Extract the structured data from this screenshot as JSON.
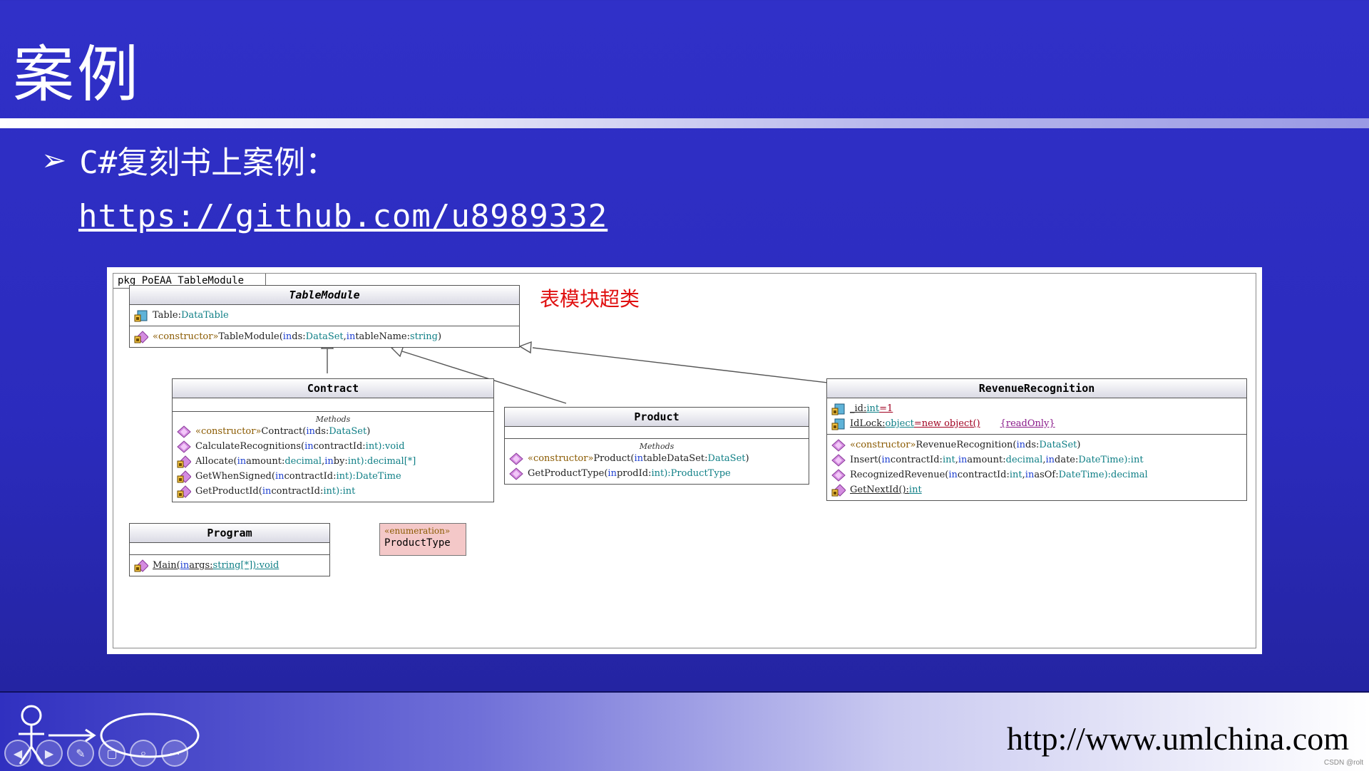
{
  "slide": {
    "title": "案例",
    "bullet": "C#复刻书上案例：",
    "link": "https://github.com/u8989332",
    "footer_url": "http://www.umlchina.com",
    "credit": "CSDN @rolt"
  },
  "diagram": {
    "package_label": "pkg PoEAA_TableModule",
    "note": "表模块超类",
    "methods_label": "Methods",
    "table_module": {
      "name": "TableModule",
      "attr_name": "Table:",
      "attr_type": "DataTable",
      "ctor_stereo": "«constructor»",
      "ctor_name": " TableModule(",
      "ctor_in1": "in",
      "ctor_p1": " ds:",
      "ctor_t1": "DataSet",
      "ctor_sep": ", ",
      "ctor_in2": "in",
      "ctor_p2": " tableName:",
      "ctor_t2": "string",
      "ctor_end": ")"
    },
    "contract": {
      "name": "Contract",
      "m1_stereo": "«constructor»",
      "m1_name": " Contract(",
      "m1_in": "in",
      "m1_p": " ds:",
      "m1_t": "DataSet",
      "m1_end": ")",
      "m2_name": "CalculateRecognitions(",
      "m2_in": "in",
      "m2_p": " contractId:",
      "m2_t": "int",
      "m2_r": "):void",
      "m3_name": "Allocate(",
      "m3_in1": "in",
      "m3_p1": " amount:",
      "m3_t1": "decimal",
      "m3_sep": ", ",
      "m3_in2": "in",
      "m3_p2": " by:",
      "m3_t2": "int",
      "m3_r": "):decimal[*]",
      "m4_name": "GetWhenSigned(",
      "m4_in": "in",
      "m4_p": " contractId:",
      "m4_t": "int",
      "m4_r": "):DateTime",
      "m5_name": "GetProductId(",
      "m5_in": "in",
      "m5_p": " contractId:",
      "m5_t": "int",
      "m5_r": "):int"
    },
    "product": {
      "name": "Product",
      "m1_stereo": "«constructor»",
      "m1_name": " Product(",
      "m1_in": "in",
      "m1_p": " tableDataSet:",
      "m1_t": "DataSet",
      "m1_end": ")",
      "m2_name": "GetProductType(",
      "m2_in": "in",
      "m2_p": " prodId:",
      "m2_t": "int",
      "m2_r": "):ProductType"
    },
    "revenue": {
      "name": "RevenueRecognition",
      "a1": "_id:",
      "a1_t": "int",
      "a1_v": "=1",
      "a2": "IdLock:",
      "a2_t": "object",
      "a2_v": "=new object()",
      "a2_st": "{readOnly}",
      "m1_stereo": "«constructor»",
      "m1_name": " RevenueRecognition(",
      "m1_in": "in",
      "m1_p": " ds:",
      "m1_t": "DataSet",
      "m1_end": ")",
      "m2_name": "Insert(",
      "m2_in1": "in",
      "m2_p1": " contractId:",
      "m2_t1": "int",
      "m2_sep1": ", ",
      "m2_in2": "in",
      "m2_p2": " amount:",
      "m2_t2": "decimal",
      "m2_sep2": ", ",
      "m2_in3": "in",
      "m2_p3": " date:",
      "m2_t3": "DateTime",
      "m2_r": "):int",
      "m3_name": "RecognizedRevenue(",
      "m3_in1": "in",
      "m3_p1": " contractId:",
      "m3_t1": "int",
      "m3_sep": ", ",
      "m3_in2": "in",
      "m3_p2": " asOf:",
      "m3_t2": "DateTime",
      "m3_r": "):decimal",
      "m4_name": "GetNextId():",
      "m4_t": "int"
    },
    "program": {
      "name": "Program",
      "m1_name": "Main(",
      "m1_in": "in",
      "m1_p": " args:",
      "m1_t": "string",
      "m1_r": "[*]):void"
    },
    "enum": {
      "stereo": "«enumeration»",
      "name": "ProductType"
    }
  },
  "nav": {
    "buttons": [
      "◀",
      "▶",
      "✎",
      "▢",
      "⌕",
      "⋯"
    ]
  },
  "colors": {
    "background": "#3030c8",
    "note_red": "#e01010",
    "enum_fill": "#f4c8c8",
    "keyword_blue": "#1d3fd0",
    "type_teal": "#0f7f86"
  },
  "icons": [
    "attribute-icon",
    "method-icon",
    "protected-method-icon",
    "static-method-icon",
    "actor-icon",
    "use-case-ellipse-icon"
  ]
}
